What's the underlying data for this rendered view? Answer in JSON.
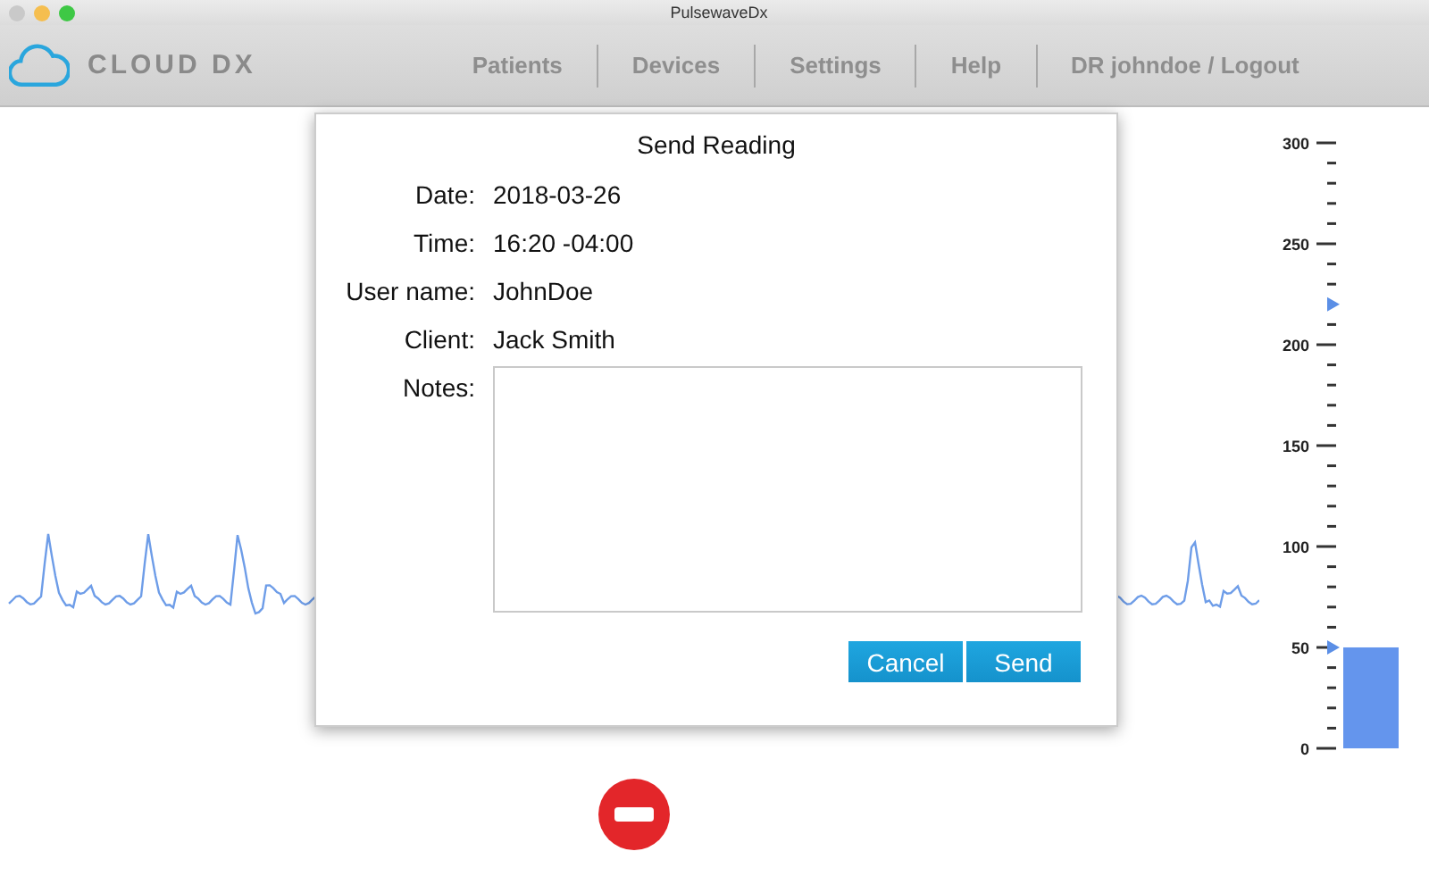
{
  "window": {
    "title": "PulsewaveDx"
  },
  "header": {
    "logo": "CLOUD DX",
    "nav": [
      "Patients",
      "Devices",
      "Settings",
      "Help",
      "DR johndoe / Logout"
    ]
  },
  "dialog": {
    "title": "Send Reading",
    "fields": [
      {
        "label": "Date:",
        "value": "2018-03-26"
      },
      {
        "label": "Time:",
        "value": "16:20 -04:00"
      },
      {
        "label": "User name:",
        "value": "JohnDoe"
      },
      {
        "label": "Client:",
        "value": "Jack Smith"
      }
    ],
    "notes": {
      "label": "Notes:"
    },
    "buttons": [
      "Cancel",
      "Send"
    ]
  },
  "gauge": {
    "ticks": [
      "300",
      "250",
      "200",
      "150",
      "100",
      "50",
      "0"
    ],
    "level": 0.1667,
    "markers": [
      {
        "level": 0.7333
      },
      {
        "level": 0.1667
      }
    ]
  }
}
